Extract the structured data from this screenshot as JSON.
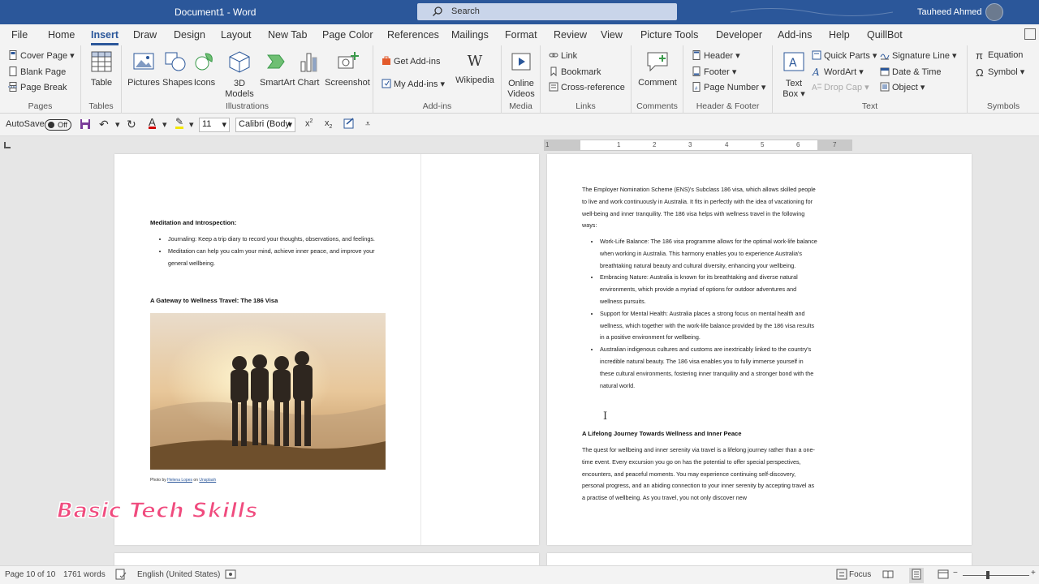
{
  "title_bar": {
    "doc_title": "Document1  -  Word",
    "search_placeholder": "Search",
    "user_name": "Tauheed Ahmed"
  },
  "tabs": [
    "File",
    "Home",
    "Insert",
    "Draw",
    "Design",
    "Layout",
    "New Tab",
    "Page Color",
    "References",
    "Mailings",
    "Format",
    "Review",
    "View",
    "Picture Tools",
    "Developer",
    "Add-ins",
    "Help",
    "QuillBot"
  ],
  "active_tab": "Insert",
  "ribbon": {
    "pages": {
      "label": "Pages",
      "cover_page": "Cover Page",
      "blank_page": "Blank Page",
      "page_break": "Page Break"
    },
    "tables": {
      "label": "Tables",
      "table": "Table"
    },
    "illustrations": {
      "label": "Illustrations",
      "pictures": "Pictures",
      "shapes": "Shapes",
      "icons": "Icons",
      "models_3d_a": "3D",
      "models_3d_b": "Models",
      "smartart": "SmartArt",
      "chart": "Chart",
      "screenshot": "Screenshot"
    },
    "addins": {
      "label": "Add-ins",
      "get_addins": "Get Add-ins",
      "my_addins": "My Add-ins",
      "wikipedia": "Wikipedia"
    },
    "media": {
      "label": "Media",
      "online_videos_a": "Online",
      "online_videos_b": "Videos"
    },
    "links": {
      "label": "Links",
      "link": "Link",
      "bookmark": "Bookmark",
      "cross_reference": "Cross-reference"
    },
    "comments": {
      "label": "Comments",
      "comment": "Comment"
    },
    "header_footer": {
      "label": "Header & Footer",
      "header": "Header",
      "footer": "Footer",
      "page_number": "Page Number"
    },
    "text": {
      "label": "Text",
      "text_box_a": "Text",
      "text_box_b": "Box",
      "quick_parts": "Quick Parts",
      "wordart": "WordArt",
      "drop_cap": "Drop Cap",
      "signature_line": "Signature Line",
      "date_time": "Date & Time",
      "object": "Object"
    },
    "symbols": {
      "label": "Symbols",
      "equation": "Equation",
      "symbol": "Symbol"
    }
  },
  "qat": {
    "autosave": "AutoSave",
    "autosave_state": "Off",
    "font_size": "11",
    "font_name": "Calibri (Body"
  },
  "ruler_numbers": [
    "1",
    "1",
    "2",
    "3",
    "4",
    "5",
    "6",
    "7"
  ],
  "left_page": {
    "heading1": "Meditation and Introspection:",
    "bullets1": [
      "Journaling: Keep a trip diary to record your thoughts, observations, and feelings.",
      "Meditation can help you calm your mind, achieve inner peace, and improve your general wellbeing."
    ],
    "heading2": "A Gateway to Wellness Travel: The 186 Visa",
    "caption_prefix": "Photo by ",
    "caption_author": "Helena Lopes",
    "caption_mid": " on ",
    "caption_site": "Unsplash"
  },
  "right_page": {
    "intro": "The Employer Nomination Scheme (ENS)'s Subclass 186 visa, which allows skilled people to live and work continuously in Australia. It fits in perfectly with the idea of vacationing for well-being and inner tranquility. The 186 visa helps with wellness travel in the following ways:",
    "bullets": [
      "Work-Life Balance: The 186 visa programme allows for the optimal work-life balance when working in Australia. This harmony enables you to experience Australia's breathtaking natural beauty and cultural diversity, enhancing your wellbeing.",
      "Embracing Nature: Australia is known for its breathtaking and diverse natural environments, which provide a myriad of options for outdoor adventures and wellness pursuits.",
      "Support for Mental Health: Australia places a strong focus on mental health and wellness, which together with the work-life balance provided by the 186 visa results in a positive environment for wellbeing.",
      "Australian indigenous cultures and customs are inextricably linked to the country's incredible natural beauty. The 186 visa enables you to fully immerse yourself in these cultural environments, fostering inner tranquility and a stronger bond with the natural world."
    ],
    "heading": "A Lifelong Journey Towards Wellness and Inner Peace",
    "para": "The quest for wellbeing and inner serenity via travel is a lifelong journey rather than a one-time event. Every excursion you go on has the potential to offer special perspectives, encounters, and peaceful moments. You may experience continuing self-discovery, personal progress, and an abiding connection to your inner serenity by accepting travel as a practise of wellbeing. As you travel, you not only discover new"
  },
  "watermark": "Basic Tech Skills",
  "status": {
    "page": "Page 10 of 10",
    "words": "1761 words",
    "language": "English (United States)",
    "focus": "Focus"
  }
}
